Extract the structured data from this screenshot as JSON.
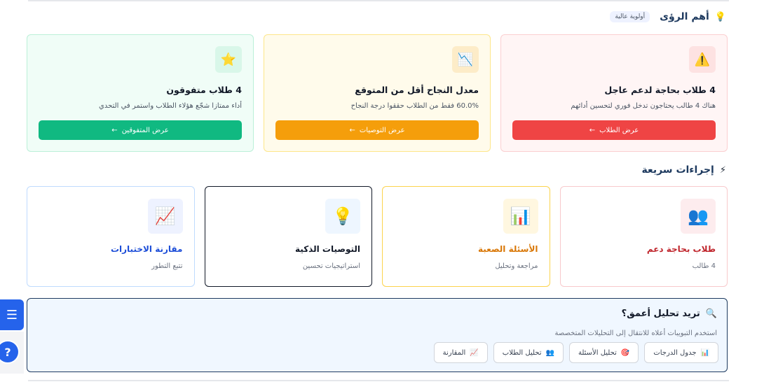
{
  "insights_section": {
    "icon": "lightbulb-icon",
    "title": "أهم الرؤى",
    "badge": "أولوية عالية"
  },
  "insights": [
    {
      "icon": "warning-icon",
      "icon_glyph": "⚠️",
      "title": "4 طلاب بحاجة لدعم عاجل",
      "desc": "هناك 4 طالب يحتاجون تدخل فوري لتحسين أدائهم",
      "button": "عرض الطلاب",
      "accent": "#ef4444",
      "bg": "#fff5f5",
      "border": "#fbcfd0",
      "icon_bg": "#fde2e2"
    },
    {
      "icon": "chart-down-icon",
      "icon_glyph": "📉",
      "title": "معدل النجاح أقل من المتوقع",
      "desc": "60.0% فقط من الطلاب حققوا درجة النجاح",
      "button": "عرض التوصيات",
      "accent": "#f59e0b",
      "bg": "#fffbeb",
      "border": "#fde68a",
      "icon_bg": "#fdecc8"
    },
    {
      "icon": "star-icon",
      "icon_glyph": "⭐",
      "title": "4 طلاب متفوقون",
      "desc": "أداء ممتازا شجّع هؤلاء الطلاب واستمر في التحدي",
      "button": "عرض المتفوقين",
      "accent": "#10b981",
      "bg": "#f0fdf7",
      "border": "#bbf0d8",
      "icon_bg": "#d9f7e9"
    }
  ],
  "quick_section": {
    "icon": "lightning-icon",
    "title": "إجراءات سريعة"
  },
  "quick_actions": [
    {
      "icon": "users-icon",
      "icon_glyph": "👥",
      "title": "طلاب بحاجة دعم",
      "sub": "4 طالب",
      "title_color": "#c0262d",
      "border": "#f8c9cc",
      "icon_bg": "#fdecee"
    },
    {
      "icon": "bar-chart-icon",
      "icon_glyph": "📊",
      "title": "الأسئلة الصعبة",
      "sub": "مراجعة وتحليل",
      "title_color": "#d97706",
      "border": "#fcd34d",
      "icon_bg": "#fff7e0"
    },
    {
      "icon": "lightbulb-icon",
      "icon_glyph": "💡",
      "title": "التوصيات الذكية",
      "sub": "استراتيجيات تحسين",
      "title_color": "#111827",
      "border": "#111827",
      "icon_bg": "#eef6ff"
    },
    {
      "icon": "line-chart-icon",
      "icon_glyph": "📈",
      "title": "مقارنة الاختبارات",
      "sub": "تتبع التطور",
      "title_color": "#1d4ed8",
      "border": "#bfdbfe",
      "icon_bg": "#eef2ff"
    }
  ],
  "deep": {
    "icon": "magnifier-icon",
    "title": "تريد تحليل أعمق؟",
    "desc": "استخدم التبويبات أعلاه للانتقال إلى التحليلات المتخصصة",
    "buttons": [
      {
        "glyph": "📊",
        "label": "جدول الدرجات",
        "icon": "bar-chart-icon"
      },
      {
        "glyph": "🎯",
        "label": "تحليل الأسئلة",
        "icon": "target-icon"
      },
      {
        "glyph": "👥",
        "label": "تحليل الطلاب",
        "icon": "users-icon"
      },
      {
        "glyph": "📈",
        "label": "المقارنة",
        "icon": "line-chart-icon"
      }
    ]
  },
  "floating": {
    "menu_glyph": "☰",
    "help_glyph": "?"
  }
}
